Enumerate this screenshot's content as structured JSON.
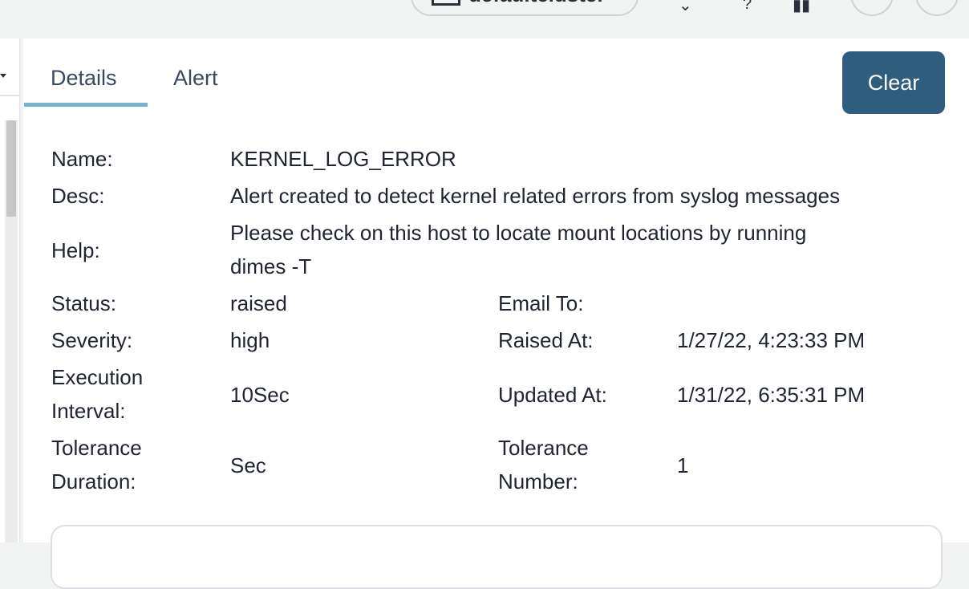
{
  "header": {
    "cluster_name": "defaultcluster"
  },
  "tabs": [
    {
      "label": "Details",
      "active": true
    },
    {
      "label": "Alert",
      "active": false
    }
  ],
  "actions": {
    "clear_label": "Clear"
  },
  "details": {
    "name_label": "Name:",
    "name_value": "KERNEL_LOG_ERROR",
    "desc_label": "Desc:",
    "desc_value": "Alert created to detect kernel related errors from syslog messages",
    "help_label": "Help:",
    "help_value_line1": "Please check on this host to locate mount locations by running",
    "help_value_line2": "dimes -T",
    "status_label": "Status:",
    "status_value": "raised",
    "email_label": "Email To:",
    "email_value": "",
    "severity_label": "Severity:",
    "severity_value": "high",
    "raised_label": "Raised At:",
    "raised_value": "1/27/22, 4:23:33 PM",
    "exec_label_line1": "Execution",
    "exec_label_line2": "Interval:",
    "exec_value": "10Sec",
    "updated_label": "Updated At:",
    "updated_value": "1/31/22, 6:35:31 PM",
    "tol_dur_label_line1": "Tolerance",
    "tol_dur_label_line2": "Duration:",
    "tol_dur_value": "Sec",
    "tol_num_label_line1": "Tolerance",
    "tol_num_label_line2": "Number:",
    "tol_num_value": "1"
  },
  "colors": {
    "primary_button": "#2f5d7e",
    "tab_underline": "#74b4d2"
  }
}
